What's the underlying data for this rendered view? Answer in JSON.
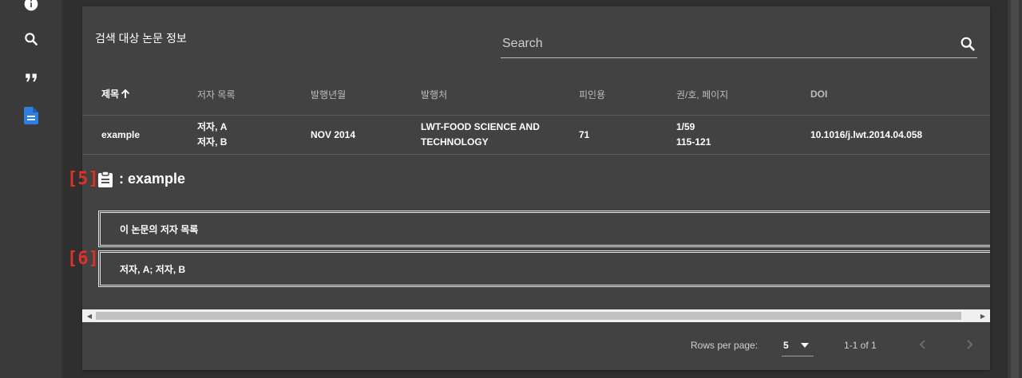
{
  "sidebar": {
    "icons": [
      {
        "name": "info-icon"
      },
      {
        "name": "search-icon"
      },
      {
        "name": "quote-icon"
      },
      {
        "name": "document-icon",
        "active": true,
        "color": "#2f7fe0"
      }
    ]
  },
  "card": {
    "title": "검색 대상 논문 정보",
    "search": {
      "placeholder": "Search",
      "value": ""
    }
  },
  "table": {
    "columns": [
      "제목",
      "저자 목록",
      "발행년월",
      "발행처",
      "피인용",
      "권/호, 페이지",
      "DOI"
    ],
    "sorted_column": "제목",
    "sort_direction": "ascending",
    "rows": [
      {
        "title": "example",
        "authors": [
          "저자, A",
          "저자, B"
        ],
        "date": "NOV 2014",
        "publisher": [
          "LWT-FOOD SCIENCE AND",
          "TECHNOLOGY"
        ],
        "citations": "71",
        "volume_pages": [
          "1/59",
          "115-121"
        ],
        "doi": "10.1016/j.lwt.2014.04.058"
      }
    ]
  },
  "detail": {
    "heading": ": example",
    "marker_5": "[5]",
    "marker_6": "[6]",
    "authors_label": "이 논문의 저자 목록",
    "authors_value": "저자, A; 저자, B"
  },
  "footer": {
    "rows_per_page_label": "Rows per page:",
    "rows_per_page_value": "5",
    "range_text": "1-1 of 1"
  },
  "colors": {
    "accent": "#2f7fe0",
    "marker": "#e0302a",
    "card_bg": "#424242",
    "page_bg": "#333333"
  }
}
